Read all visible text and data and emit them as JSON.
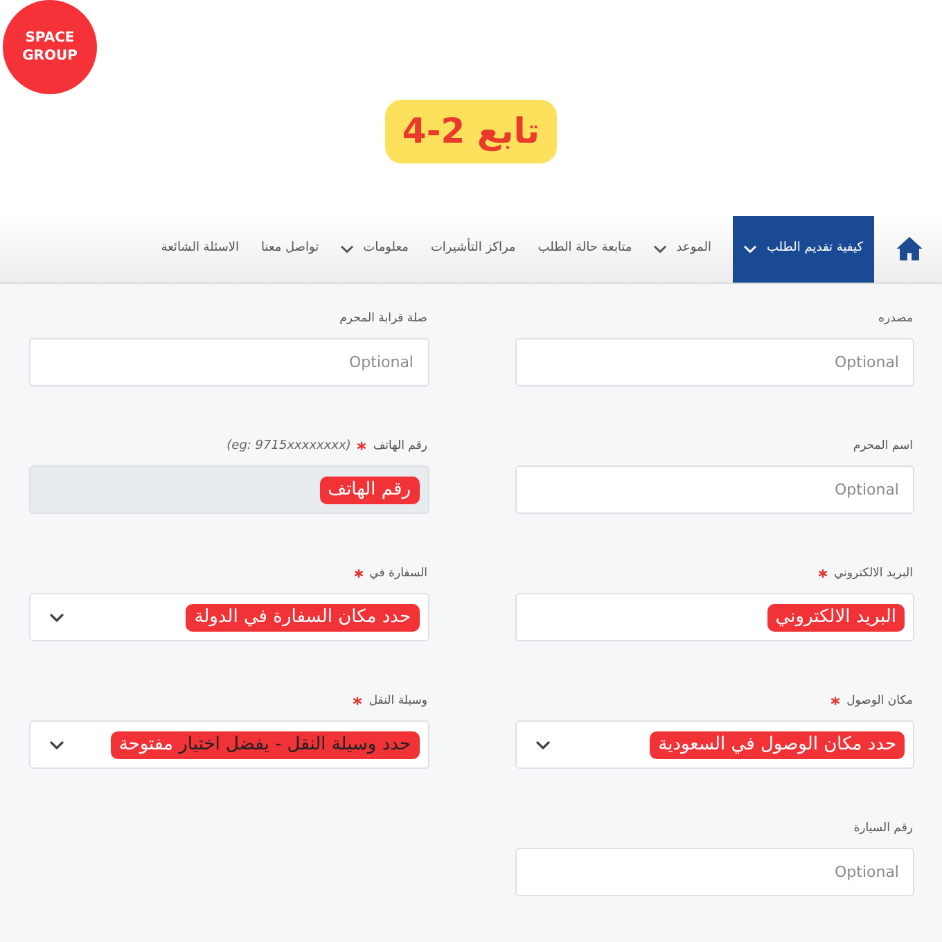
{
  "logo_text": "SPACE GROUP",
  "title_badge": "تابع 2-4",
  "nav": {
    "items": [
      {
        "label": "كيفية تقديم الطلب",
        "selected": true,
        "has_dropdown": true
      },
      {
        "label": "الموعد",
        "selected": false,
        "has_dropdown": true
      },
      {
        "label": "متابعة حالة الطلب",
        "selected": false,
        "has_dropdown": false
      },
      {
        "label": "مراكز التأشيرات",
        "selected": false,
        "has_dropdown": false
      },
      {
        "label": "معلومات",
        "selected": false,
        "has_dropdown": true
      },
      {
        "label": "تواصل معنا",
        "selected": false,
        "has_dropdown": false
      },
      {
        "label": "الاسئلة الشائعة",
        "selected": false,
        "has_dropdown": false
      }
    ]
  },
  "form": {
    "fields": [
      {
        "label": "مصدره",
        "required": false,
        "kind": "text",
        "disabled": false,
        "placeholder": "Optional"
      },
      {
        "label": "صلة قرابة المحرم",
        "required": false,
        "kind": "text",
        "disabled": false,
        "placeholder": "Optional"
      },
      {
        "label": "اسم المحرم",
        "required": false,
        "kind": "text",
        "disabled": false,
        "placeholder": "Optional"
      },
      {
        "label": "رقم الهاتف",
        "required": true,
        "hint": "(eg: 9715xxxxxxxx)",
        "kind": "text",
        "disabled": true,
        "callout": [
          {
            "text": "رقم الهاتف",
            "highlighted": true
          }
        ]
      },
      {
        "label": "البريد الالكتروني",
        "required": true,
        "kind": "text",
        "disabled": false,
        "callout": [
          {
            "text": "البريد الالكتروني",
            "highlighted": true
          }
        ]
      },
      {
        "label": "السفارة في",
        "required": true,
        "kind": "select",
        "disabled": false,
        "callout": [
          {
            "text": "حدد مكان السفارة في الدولة",
            "highlighted": true
          }
        ]
      },
      {
        "label": "مكان الوصول",
        "required": true,
        "kind": "select",
        "disabled": false,
        "callout": [
          {
            "text": "حدد مكان الوصول في السعودية",
            "highlighted": true
          }
        ]
      },
      {
        "label": "وسيلة النقل",
        "required": true,
        "kind": "select",
        "disabled": false,
        "callout": [
          {
            "text": "حدد وسيلة النقل - يفضل اختيار",
            "highlighted": false
          },
          {
            "text": "مفتوحة",
            "highlighted": true
          }
        ]
      },
      {
        "label": "رقم السيارة",
        "required": false,
        "kind": "text",
        "disabled": false,
        "placeholder": "Optional"
      }
    ]
  }
}
